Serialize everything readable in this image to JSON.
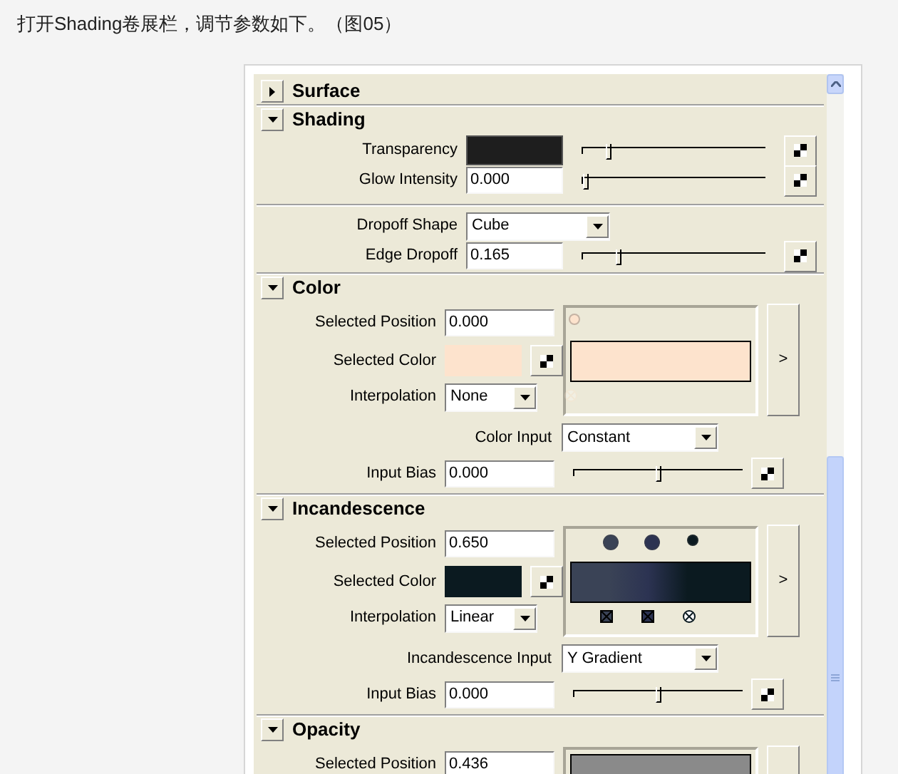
{
  "caption": "打开Shading卷展栏，调节参数如下。（图05）",
  "sections": [
    {
      "title": "Surface",
      "expanded": false
    },
    {
      "title": "Shading",
      "expanded": true,
      "rows": [
        {
          "kind": "color_slider",
          "label": "Transparency",
          "color": "#1e1e1e",
          "level": 0.15
        },
        {
          "kind": "number_slider",
          "label": "Glow Intensity",
          "value": "0.000",
          "level": 0.02
        },
        {
          "kind": "divider"
        },
        {
          "kind": "dropdown",
          "label": "Dropoff Shape",
          "value": "Cube"
        },
        {
          "kind": "number_slider",
          "label": "Edge Dropoff",
          "value": "0.165",
          "level": 0.2
        }
      ]
    },
    {
      "title": "Color",
      "expanded": true,
      "ramp": {
        "position": {
          "label": "Selected Position",
          "value": "0.000"
        },
        "selected_color": {
          "label": "Selected Color",
          "color": "#fde3cd"
        },
        "interpolation": {
          "label": "Interpolation",
          "value": "None"
        },
        "stops": [
          {
            "color": "#fde3cd",
            "level": 0.02,
            "selected": true
          }
        ],
        "more": ">",
        "input": {
          "label": "Color Input",
          "value": "Constant"
        },
        "bias": {
          "label": "Input Bias",
          "value": "0.000",
          "level": 0.5
        }
      }
    },
    {
      "title": "Incandescence",
      "expanded": true,
      "ramp": {
        "position": {
          "label": "Selected Position",
          "value": "0.650"
        },
        "selected_color": {
          "label": "Selected Color",
          "color": "#0b1a20"
        },
        "interpolation": {
          "label": "Interpolation",
          "value": "Linear"
        },
        "stops": [
          {
            "color": "#3a4356",
            "level": 0.21,
            "selected": false
          },
          {
            "color": "#2c3352",
            "level": 0.43,
            "selected": false
          },
          {
            "color": "#0b1a20",
            "level": 0.65,
            "selected": true
          }
        ],
        "more": ">",
        "input": {
          "label": "Incandescence Input",
          "value": "Y Gradient"
        },
        "bias": {
          "label": "Input Bias",
          "value": "0.000",
          "level": 0.5
        }
      }
    },
    {
      "title": "Opacity",
      "expanded": true,
      "ramp": {
        "position": {
          "label": "Selected Position",
          "value": "0.436"
        }
      }
    }
  ]
}
